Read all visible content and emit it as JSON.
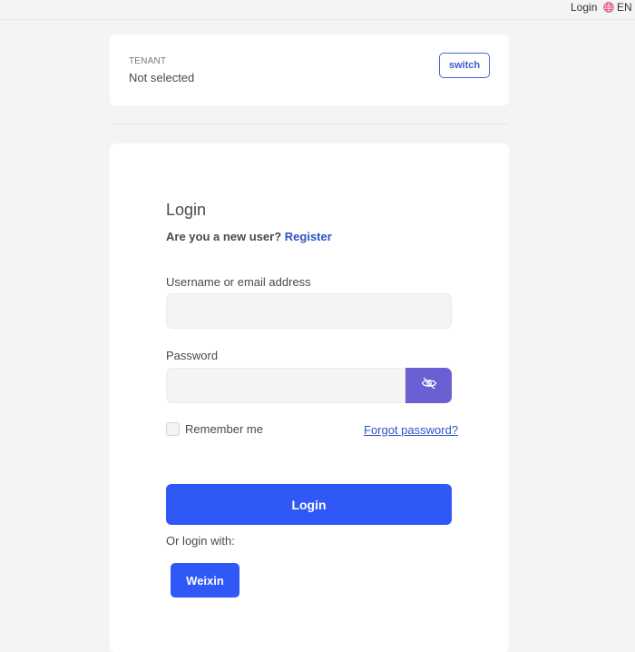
{
  "topbar": {
    "login_label": "Login",
    "language_label": "EN",
    "globe_icon": "globe-icon"
  },
  "tenant": {
    "label": "TENANT",
    "value": "Not selected",
    "switch_label": "switch"
  },
  "login": {
    "title": "Login",
    "new_user_prompt": "Are you a new user?",
    "register_label": "Register",
    "username_label": "Username or email address",
    "username_value": "",
    "password_label": "Password",
    "password_value": "",
    "toggle_visibility_icon": "eye-slash-icon",
    "remember_label": "Remember me",
    "remember_checked": false,
    "forgot_label": "Forgot password?",
    "submit_label": "Login",
    "or_login_with": "Or login with:",
    "providers": [
      {
        "label": "Weixin"
      }
    ]
  },
  "colors": {
    "primary": "#3058f6",
    "link": "#2f52c7",
    "eye_button": "#6a5fd3",
    "background": "#f4f4f6",
    "card": "#ffffff"
  }
}
